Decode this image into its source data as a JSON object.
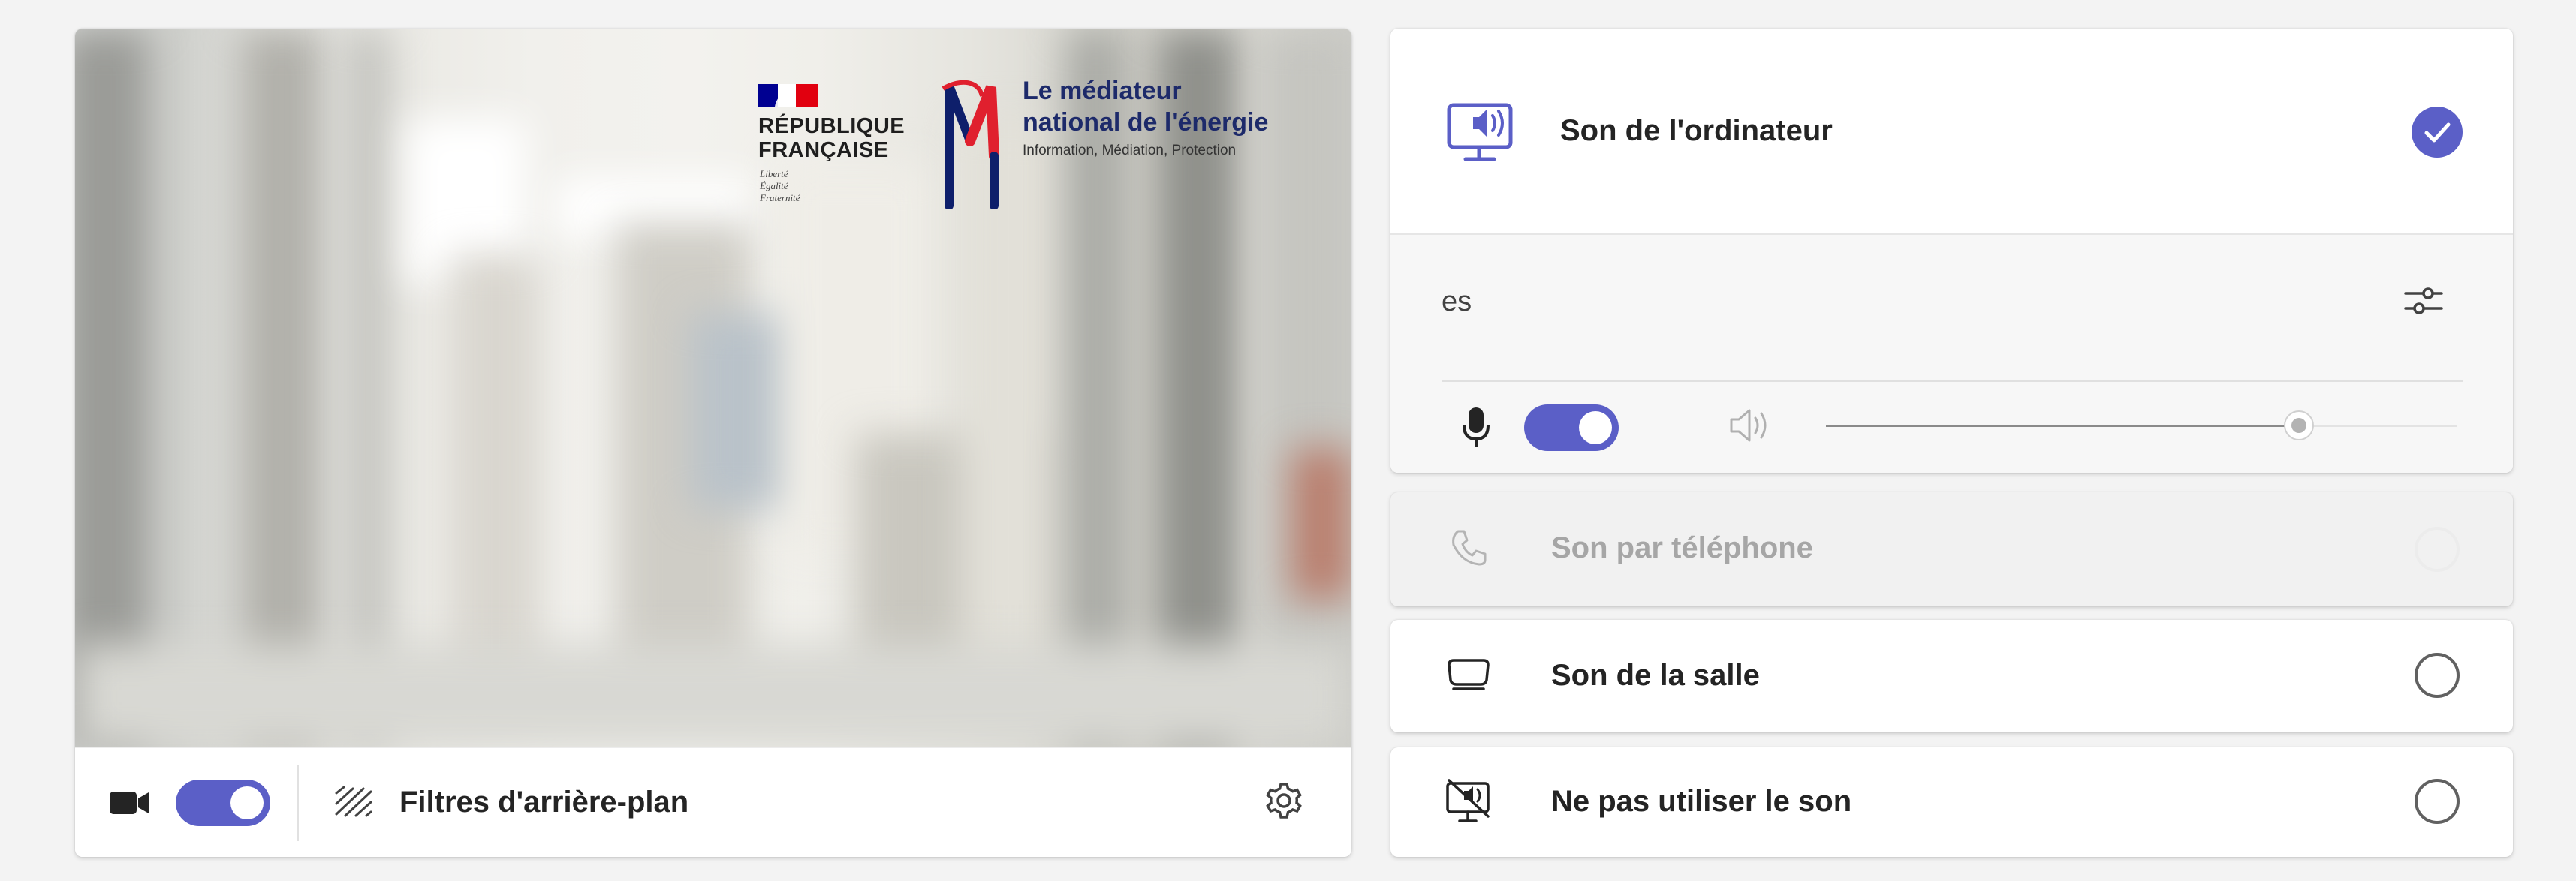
{
  "preview": {
    "logos": {
      "republique_line1": "RÉPUBLIQUE",
      "republique_line2": "FRANÇAISE",
      "motto": [
        "Liberté",
        "Égalité",
        "Fraternité"
      ],
      "mediateur_line1": "Le médiateur",
      "mediateur_line2": "national de l'énergie",
      "mediateur_tagline": "Information, Médiation, Protection"
    },
    "camera_on": true,
    "background_filters_label": "Filtres d'arrière-plan"
  },
  "audio_options": {
    "computer_audio": {
      "label": "Son de l'ordinateur",
      "selected": true,
      "device_name": "es",
      "mic_on": true,
      "speaker_volume": 0.75
    },
    "phone_audio": {
      "label": "Son par téléphone",
      "enabled": false
    },
    "room_audio": {
      "label": "Son de la salle",
      "selected": false
    },
    "no_audio": {
      "label": "Ne pas utiliser le son",
      "selected": false
    }
  },
  "colors": {
    "accent": "#5b5fc7",
    "text": "#242424",
    "disabled_text": "#a6a6a6",
    "background": "#f3f3f3"
  },
  "icons": {
    "camera": "video-camera-icon",
    "filters": "background-blur-icon",
    "settings": "gear-icon",
    "computer_audio": "monitor-speaker-icon",
    "device_settings": "sliders-icon",
    "mic": "microphone-icon",
    "speaker": "speaker-icon",
    "phone": "phone-icon",
    "room": "room-speaker-icon",
    "no_audio": "monitor-muted-icon"
  }
}
